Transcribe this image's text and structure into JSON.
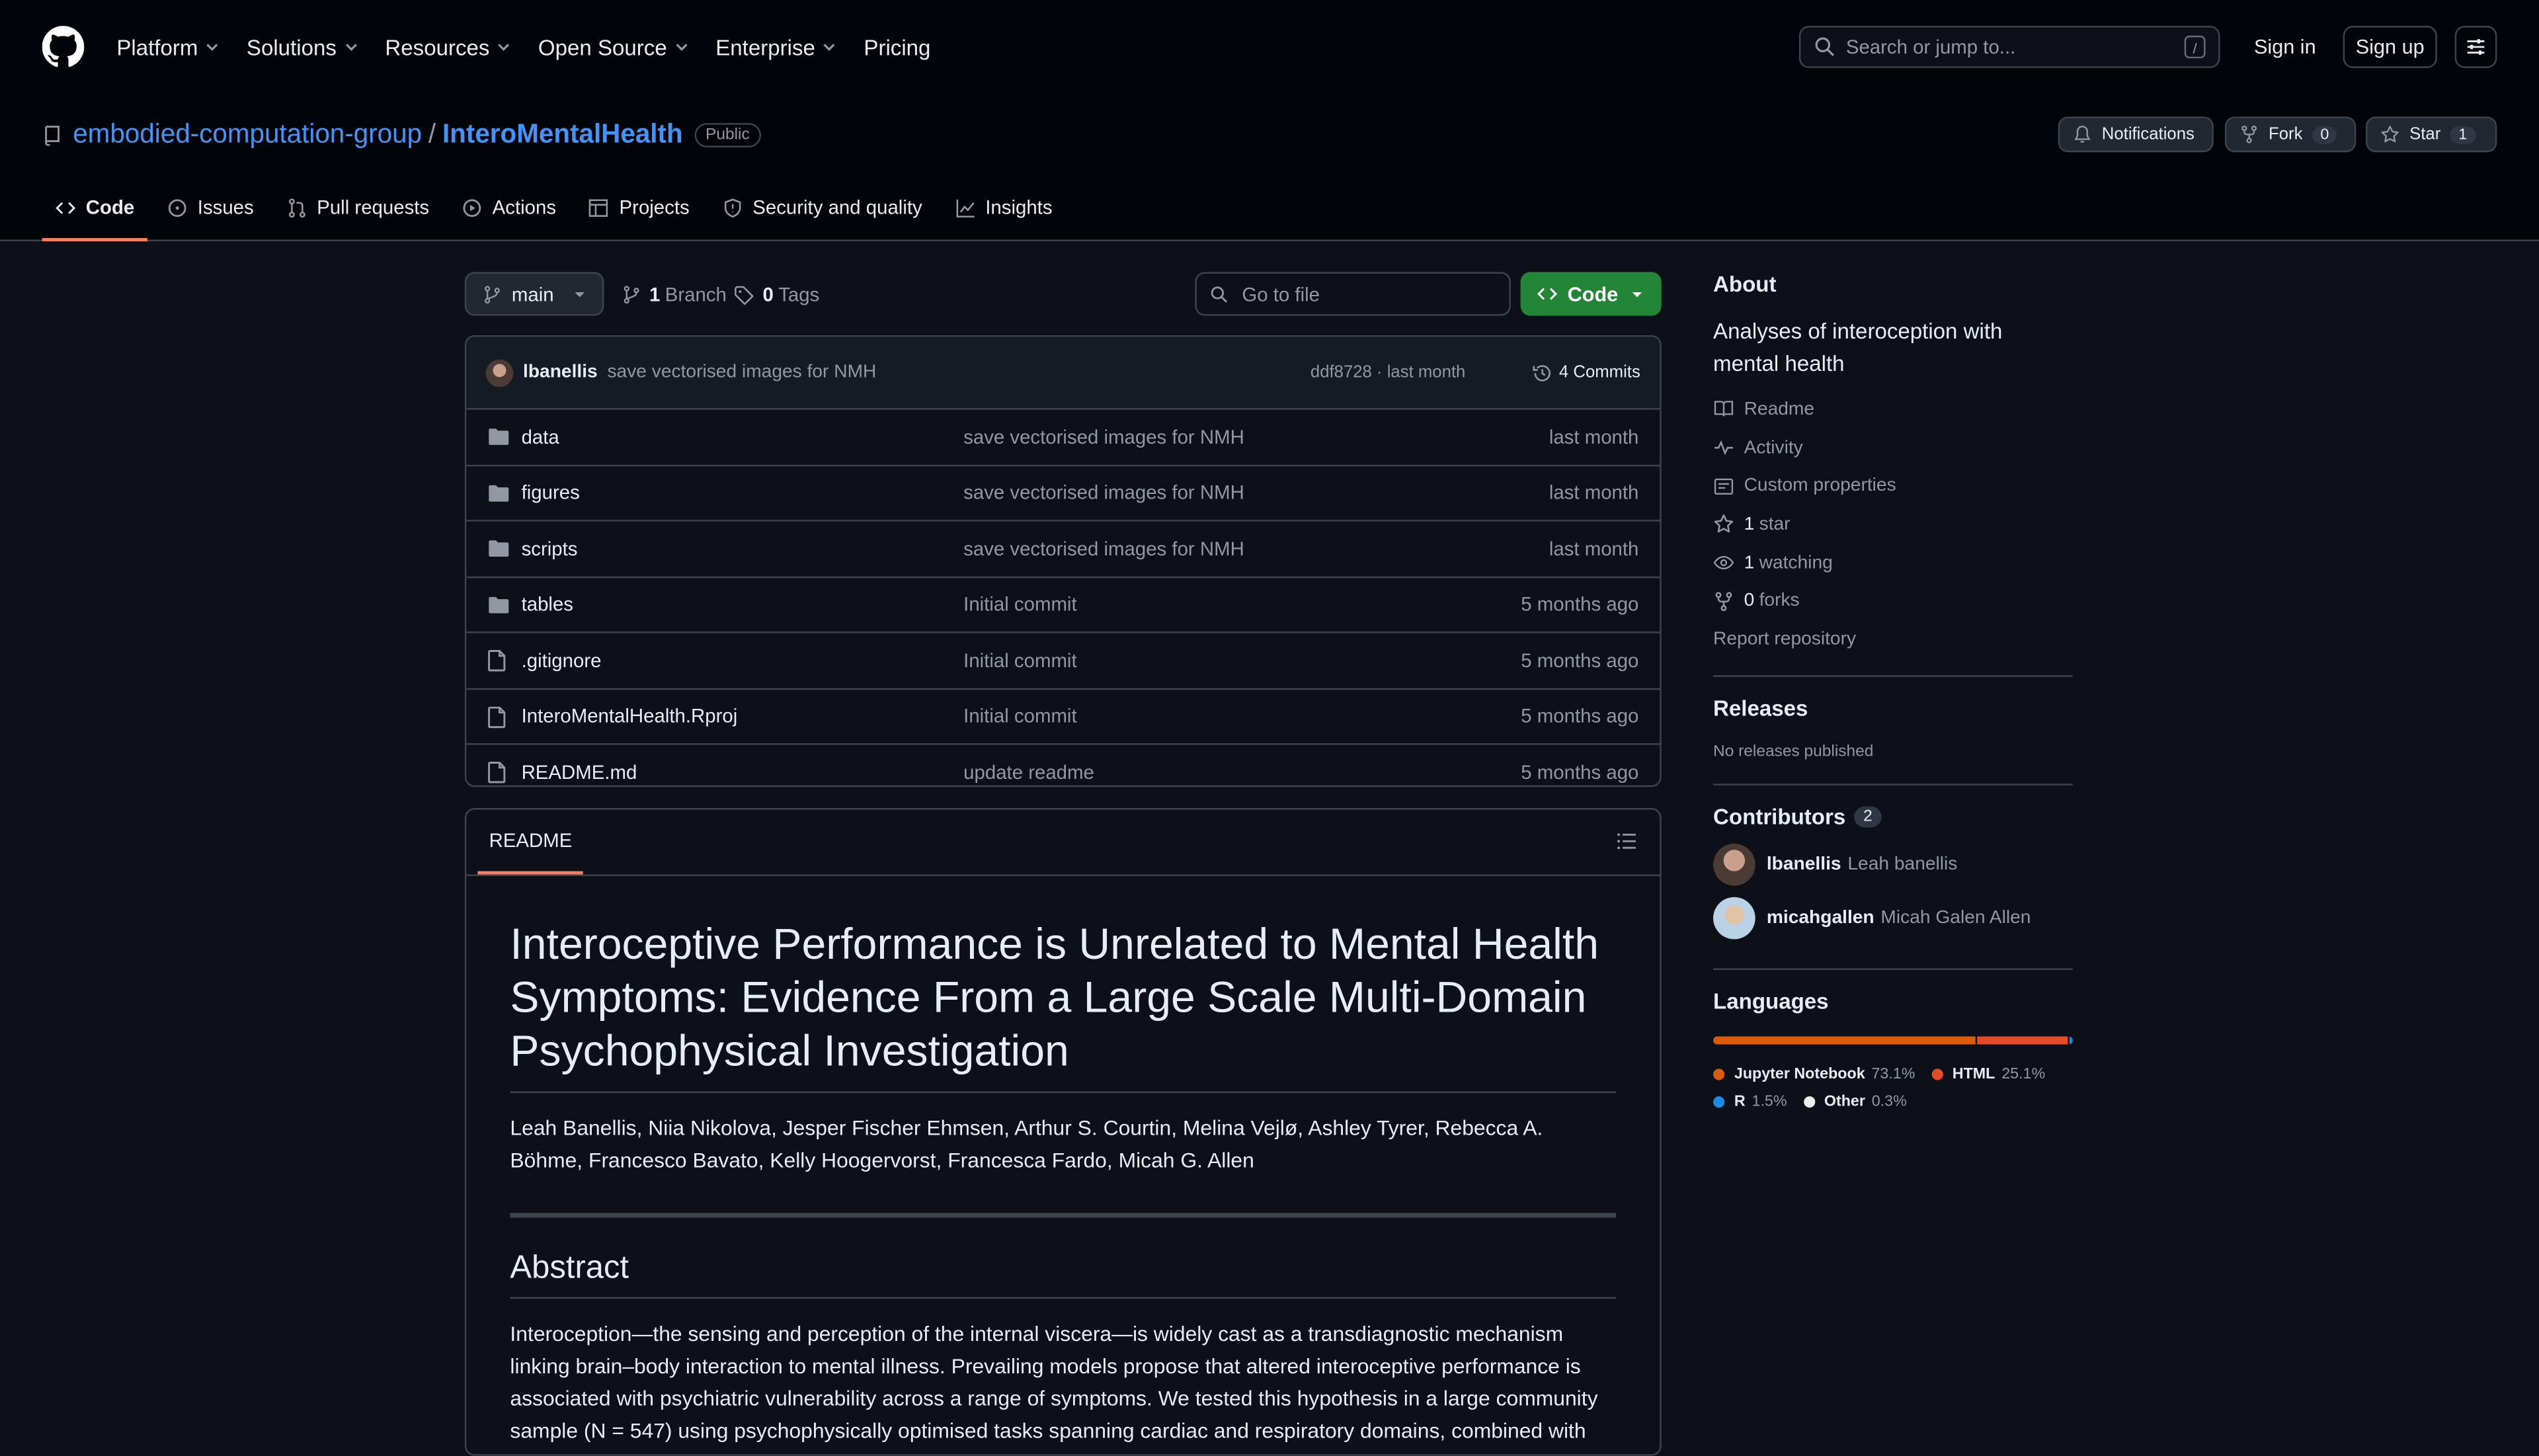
{
  "header": {
    "nav": [
      "Platform",
      "Solutions",
      "Resources",
      "Open Source",
      "Enterprise",
      "Pricing"
    ],
    "search_placeholder": "Search or jump to...",
    "search_shortcut": "/",
    "sign_in": "Sign in",
    "sign_up": "Sign up"
  },
  "repo": {
    "owner": "embodied-computation-group",
    "separator": "/",
    "name": "InteroMentalHealth",
    "visibility": "Public",
    "notifications": "Notifications",
    "fork_label": "Fork",
    "fork_count": "0",
    "star_label": "Star",
    "star_count": "1"
  },
  "tabs": [
    "Code",
    "Issues",
    "Pull requests",
    "Actions",
    "Projects",
    "Security and quality",
    "Insights"
  ],
  "toolbar": {
    "branch": "main",
    "branches_count": "1",
    "branches_label": "Branch",
    "tags_count": "0",
    "tags_label": "Tags",
    "goto_placeholder": "Go to file",
    "code_label": "Code"
  },
  "latest_commit": {
    "user": "lbanellis",
    "message": "save vectorised images for NMH",
    "sha_time": "ddf8728 · last month",
    "commits": "4 Commits"
  },
  "files": [
    {
      "type": "dir",
      "name": "data",
      "message": "save vectorised images for NMH",
      "time": "last month"
    },
    {
      "type": "dir",
      "name": "figures",
      "message": "save vectorised images for NMH",
      "time": "last month"
    },
    {
      "type": "dir",
      "name": "scripts",
      "message": "save vectorised images for NMH",
      "time": "last month"
    },
    {
      "type": "dir",
      "name": "tables",
      "message": "Initial commit",
      "time": "5 months ago"
    },
    {
      "type": "file",
      "name": ".gitignore",
      "message": "Initial commit",
      "time": "5 months ago"
    },
    {
      "type": "file",
      "name": "InteroMentalHealth.Rproj",
      "message": "Initial commit",
      "time": "5 months ago"
    },
    {
      "type": "file",
      "name": "README.md",
      "message": "update readme",
      "time": "5 months ago"
    }
  ],
  "readme": {
    "tab": "README",
    "title": "Interoceptive Performance is Unrelated to Mental Health Symptoms: Evidence From a Large Scale Multi-Domain Psychophysical Investigation",
    "authors": "Leah Banellis, Niia Nikolova, Jesper Fischer Ehmsen, Arthur S. Courtin, Melina Vejlø, Ashley Tyrer, Rebecca A. Böhme, Francesco Bavato, Kelly Hoogervorst, Francesca Fardo, Micah G. Allen",
    "abstract_heading": "Abstract",
    "abstract": "Interoception—the sensing and perception of the internal viscera—is widely cast as a transdiagnostic mechanism linking brain–body interaction to mental illness. Prevailing models propose that altered interoceptive performance is associated with psychiatric vulnerability across a range of symptoms. We tested this hypothesis in a large community sample (N = 547) using psychophysically optimised tasks spanning cardiac and respiratory domains, combined with"
  },
  "about": {
    "heading": "About",
    "description": "Analyses of interoception with mental health",
    "links": [
      {
        "icon": "book-icon",
        "count": "",
        "label": "Readme"
      },
      {
        "icon": "pulse-icon",
        "count": "",
        "label": "Activity"
      },
      {
        "icon": "note-icon",
        "count": "",
        "label": "Custom properties"
      },
      {
        "icon": "star-icon",
        "count": "1",
        "label": "star"
      },
      {
        "icon": "eye-icon",
        "count": "1",
        "label": "watching"
      },
      {
        "icon": "fork-icon",
        "count": "0",
        "label": "forks"
      }
    ],
    "report": "Report repository"
  },
  "releases": {
    "heading": "Releases",
    "empty": "No releases published"
  },
  "contributors": {
    "heading": "Contributors",
    "count": "2",
    "people": [
      {
        "login": "lbanellis",
        "name": "Leah banellis"
      },
      {
        "login": "micahgallen",
        "name": "Micah Galen Allen"
      }
    ]
  },
  "languages": {
    "heading": "Languages",
    "items": [
      {
        "name": "Jupyter Notebook",
        "pct": "73.1%",
        "value": 73.1,
        "color": "#DA5B0B"
      },
      {
        "name": "HTML",
        "pct": "25.1%",
        "value": 25.1,
        "color": "#e34c26"
      },
      {
        "name": "R",
        "pct": "1.5%",
        "value": 1.5,
        "color": "#198CE7"
      },
      {
        "name": "Other",
        "pct": "0.3%",
        "value": 0.3,
        "color": "#ededed"
      }
    ]
  }
}
